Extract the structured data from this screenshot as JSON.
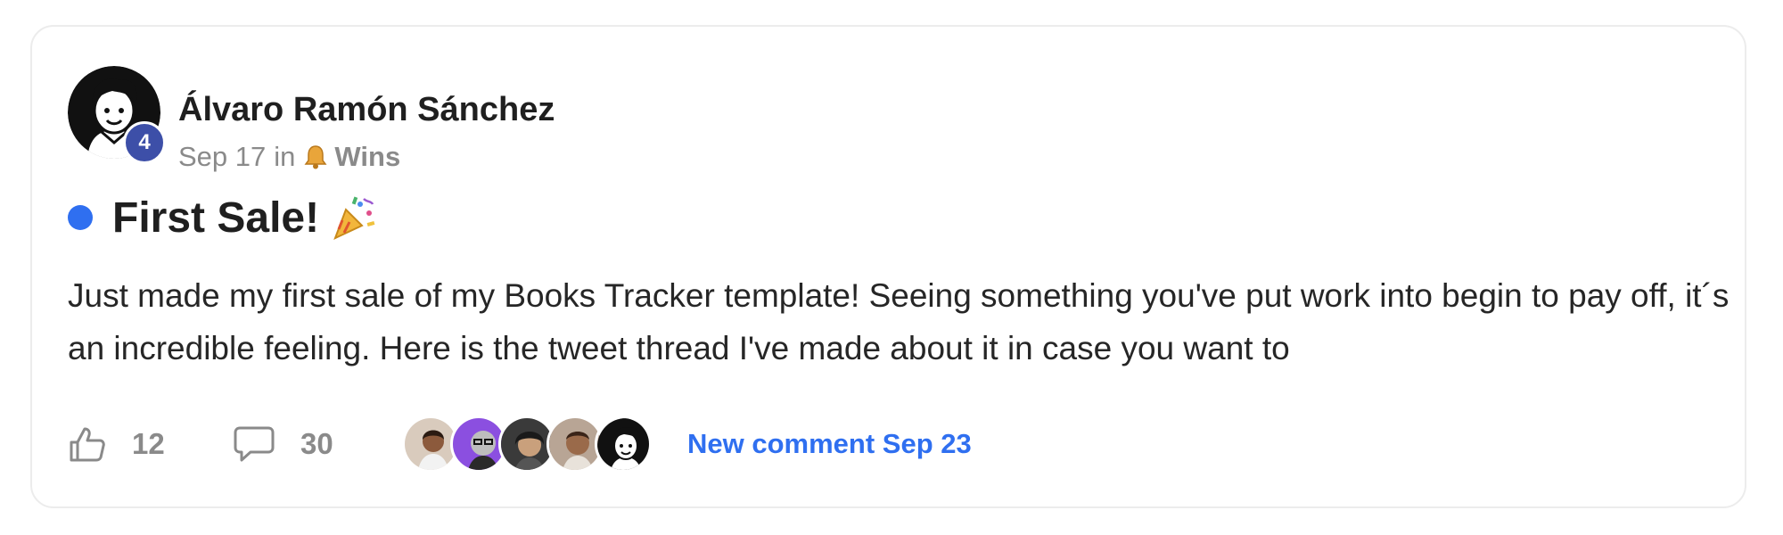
{
  "post": {
    "author": {
      "name": "Álvaro Ramón Sánchez",
      "level": "4",
      "avatar_icon": "cartoon-person-avatar-icon"
    },
    "meta": {
      "date": "Sep 17",
      "in_label": "in",
      "space_icon": "bell-icon",
      "space_name": "Wins"
    },
    "title": "First Sale!",
    "title_icon": "party-popper-icon",
    "unread_color": "#2f6ff0",
    "body": "Just made my first sale of my Books Tracker template! Seeing something you've put work into begin to pay off, it´s an incredible feeling. Here is the tweet thread I've made about it in case you want to",
    "footer": {
      "likes_count": "12",
      "comments_count": "30",
      "like_icon": "thumbs-up-icon",
      "comment_icon": "comment-bubble-icon",
      "participants": [
        {
          "icon": "participant-avatar-icon"
        },
        {
          "icon": "participant-avatar-icon"
        },
        {
          "icon": "participant-avatar-icon"
        },
        {
          "icon": "participant-avatar-icon"
        },
        {
          "icon": "participant-avatar-icon"
        }
      ],
      "new_comment_label": "New comment Sep 23"
    }
  },
  "colors": {
    "accent": "#2f6ff0",
    "badge": "#3d4fa8",
    "muted_text": "#8a8a8a",
    "border": "#ececec"
  }
}
